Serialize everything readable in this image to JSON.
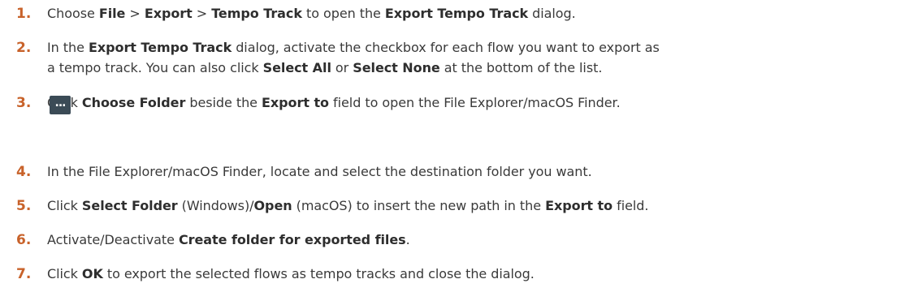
{
  "steps": [
    {
      "num": "1.",
      "parts": [
        {
          "t": "Choose "
        },
        {
          "t": "File",
          "b": true
        },
        {
          "t": " > "
        },
        {
          "t": "Export",
          "b": true
        },
        {
          "t": " > "
        },
        {
          "t": "Tempo Track",
          "b": true
        },
        {
          "t": " to open the "
        },
        {
          "t": "Export Tempo Track",
          "b": true
        },
        {
          "t": " dialog."
        }
      ]
    },
    {
      "num": "2.",
      "lines": [
        [
          {
            "t": "In the "
          },
          {
            "t": "Export Tempo Track",
            "b": true
          },
          {
            "t": " dialog, activate the checkbox for each flow you want to export as"
          }
        ],
        [
          {
            "t": "a tempo track. You can also click "
          },
          {
            "t": "Select All",
            "b": true
          },
          {
            "t": " or "
          },
          {
            "t": "Select None",
            "b": true
          },
          {
            "t": " at the bottom of the list."
          }
        ]
      ]
    },
    {
      "num": "3.",
      "parts": [
        {
          "t": "Click "
        },
        {
          "t": "Choose Folder",
          "b": true
        },
        {
          "t": " beside the "
        },
        {
          "t": "Export to",
          "b": true
        },
        {
          "t": " field to open the File Explorer/macOS Finder."
        }
      ],
      "button_glyph": "..."
    },
    {
      "num": "4.",
      "parts": [
        {
          "t": "In the File Explorer/macOS Finder, locate and select the destination folder you want."
        }
      ]
    },
    {
      "num": "5.",
      "parts": [
        {
          "t": "Click "
        },
        {
          "t": "Select Folder",
          "b": true
        },
        {
          "t": " (Windows)/"
        },
        {
          "t": "Open",
          "b": true
        },
        {
          "t": " (macOS) to insert the new path in the "
        },
        {
          "t": "Export to",
          "b": true
        },
        {
          "t": " field."
        }
      ]
    },
    {
      "num": "6.",
      "parts": [
        {
          "t": "Activate/Deactivate "
        },
        {
          "t": "Create folder for exported files",
          "b": true
        },
        {
          "t": "."
        }
      ]
    },
    {
      "num": "7.",
      "parts": [
        {
          "t": "Click "
        },
        {
          "t": "OK",
          "b": true
        },
        {
          "t": " to export the selected flows as tempo tracks and close the dialog."
        }
      ]
    }
  ]
}
